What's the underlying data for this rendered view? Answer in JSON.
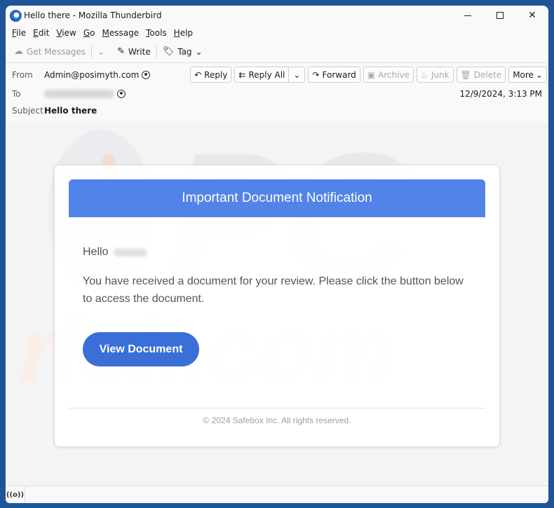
{
  "window": {
    "title": "Hello there - Mozilla Thunderbird",
    "controls": {
      "minimize": "minimize",
      "maximize": "maximize",
      "close": "✕"
    }
  },
  "menubar": {
    "items": [
      {
        "label": "File",
        "accel": "F",
        "rest": "ile"
      },
      {
        "label": "Edit",
        "accel": "E",
        "rest": "dit"
      },
      {
        "label": "View",
        "accel": "V",
        "rest": "iew"
      },
      {
        "label": "Go",
        "accel": "G",
        "rest": "o"
      },
      {
        "label": "Message",
        "accel": "M",
        "rest": "essage"
      },
      {
        "label": "Tools",
        "accel": "T",
        "rest": "ools"
      },
      {
        "label": "Help",
        "accel": "H",
        "rest": "elp"
      }
    ]
  },
  "toolbar": {
    "get_messages": "Get Messages",
    "write": "Write",
    "tag": "Tag"
  },
  "message_header": {
    "from_label": "From",
    "from_value": "Admin@posimyth.com",
    "to_label": "To",
    "to_value_redacted": true,
    "subject_label": "Subject",
    "subject_value": "Hello there",
    "date": "12/9/2024, 3:13 PM",
    "actions": {
      "reply": "Reply",
      "reply_all": "Reply All",
      "forward": "Forward",
      "archive": "Archive",
      "junk": "Junk",
      "delete": "Delete",
      "more": "More"
    }
  },
  "email": {
    "banner_title": "Important Document Notification",
    "greeting": "Hello",
    "body": "You have received a document for your review. Please click the button below to access the document.",
    "cta_label": "View Document",
    "footer": "© 2024 Safebox Inc. All rights reserved.",
    "colors": {
      "banner": "#5283e8",
      "cta": "#3a6fd8"
    }
  },
  "watermark": {
    "top": "PC",
    "bottom": "risk.com"
  },
  "statusbar": {
    "icon": "((o))"
  }
}
